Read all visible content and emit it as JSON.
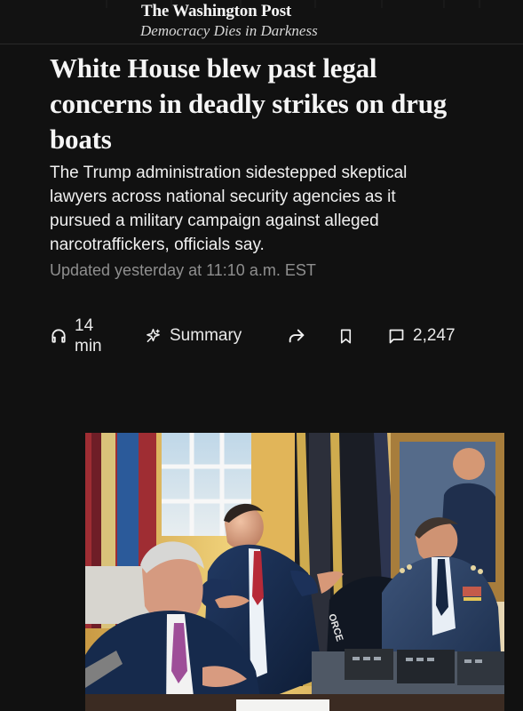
{
  "header": {
    "brand": "The Washington Post",
    "tagline": "Democracy Dies in Darkness"
  },
  "article": {
    "headline": "White House blew past legal concerns in deadly strikes on drug boats",
    "dek": "The Trump administration sidestepped skeptical lawyers across national security agencies as it pursued a military campaign against alleged narcotraffickers, officials say.",
    "updated": "Updated yesterday at 11:10 a.m. EST"
  },
  "actions": {
    "listen_minutes": "14",
    "listen_unit": "min",
    "summary_label": "Summary",
    "comment_count": "2,247",
    "icons": {
      "listen": "headphones-icon",
      "summary": "sparkle-icon",
      "share": "share-icon",
      "save": "bookmark-icon",
      "comments": "comment-icon"
    }
  },
  "image": {
    "description_visible": "",
    "visible_text": "ORCE"
  },
  "colors": {
    "background": "#111111",
    "text": "#f2f2f2",
    "muted": "#8f8f8f"
  }
}
